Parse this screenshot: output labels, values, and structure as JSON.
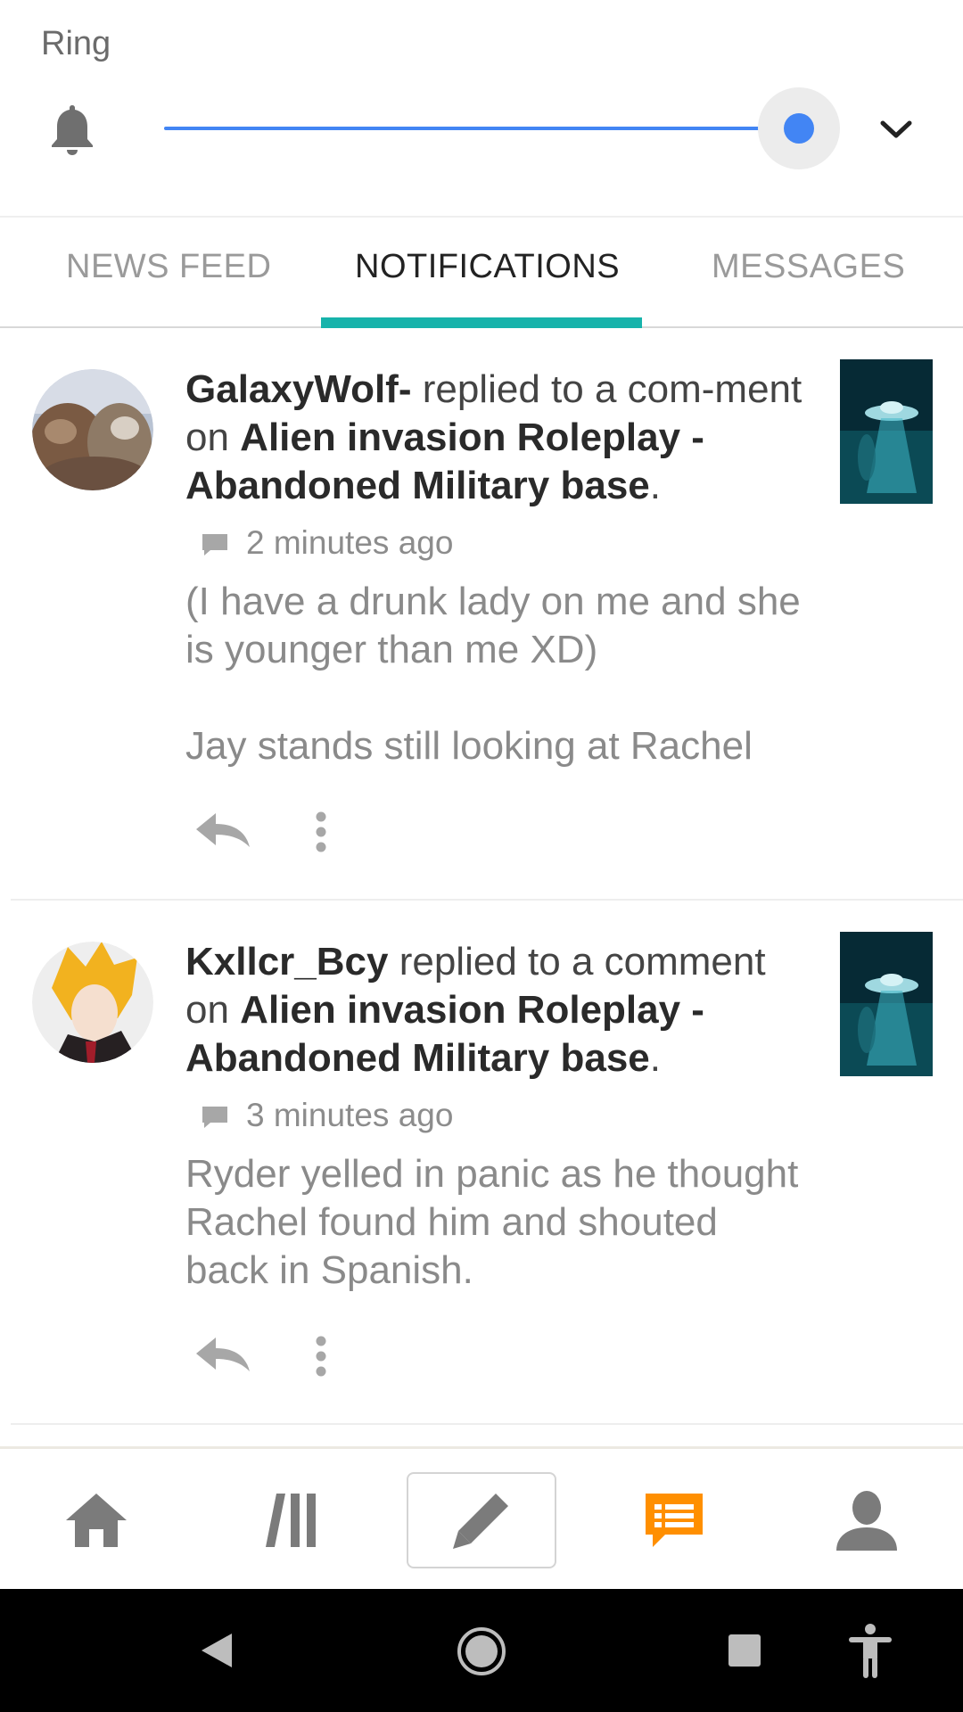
{
  "volume": {
    "label": "Ring",
    "level_percent": 100,
    "accent_color": "#4285f4"
  },
  "tabs": [
    {
      "label": "NEWS FEED",
      "active": false
    },
    {
      "label": "NOTIFICATIONS",
      "active": true
    },
    {
      "label": "MESSAGES",
      "active": false
    }
  ],
  "tab_indicator_color": "#17b3ab",
  "notifications": [
    {
      "user": "GalaxyWolf-",
      "action": " replied to a com-ment on ",
      "story": "Alien invasion Roleplay - Abandoned Military base",
      "end": ".",
      "time": "2 minutes ago",
      "body": "(I have a drunk lady on me and she is younger than me XD)\n\nJay stands still looking at Rachel"
    },
    {
      "user": "Kxllcr_Bcy",
      "action": " replied to a comment on ",
      "story": "Alien invasion Roleplay - Abandoned Military base",
      "end": ".",
      "time": "3 minutes ago",
      "body": "Ryder yelled in panic as he thought Rachel found him and shouted back in Spanish."
    }
  ],
  "bottom_nav": [
    {
      "icon": "home-icon",
      "active": false
    },
    {
      "icon": "library-icon",
      "active": false
    },
    {
      "icon": "pencil-icon",
      "active": false
    },
    {
      "icon": "notifications-chat-icon",
      "active": true,
      "color": "#ff8f00"
    },
    {
      "icon": "profile-icon",
      "active": false
    }
  ],
  "system_nav": [
    "back-icon",
    "home-circle-icon",
    "recents-icon",
    "accessibility-icon"
  ]
}
